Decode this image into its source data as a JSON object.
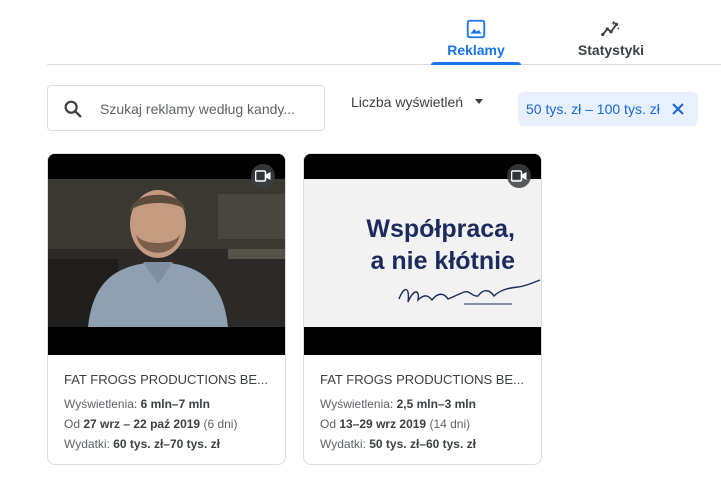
{
  "tabs": [
    {
      "label": "Reklamy",
      "icon": "image-icon",
      "active": true
    },
    {
      "label": "Statystyki",
      "icon": "insights-icon",
      "active": false
    }
  ],
  "search": {
    "placeholder": "Szukaj reklamy według kandy..."
  },
  "filter_dropdown": {
    "label": "Liczba wyświetleń"
  },
  "chip": {
    "label": "50 tys. zł – 100 tys. zł"
  },
  "cards": [
    {
      "advertiser": "FAT FROGS PRODUCTIONS BE...",
      "views_label": "Wyświetlenia:",
      "views_value": "6 mln–7 mln",
      "date_prefix": "Od",
      "date_value": "27 wrz – 22 paź 2019",
      "date_days": "(6 dni)",
      "spend_label": "Wydatki:",
      "spend_value": "60 tys. zł–70 tys. zł"
    },
    {
      "advertiser": "FAT FROGS PRODUCTIONS BE...",
      "views_label": "Wyświetlenia:",
      "views_value": "2,5 mln–3 mln",
      "date_prefix": "Od",
      "date_value": "13–29 wrz 2019",
      "date_days": "(14 dni)",
      "spend_label": "Wydatki:",
      "spend_value": "50 tys. zł–60 tys. zł",
      "thumbnail_line1": "Współpraca,",
      "thumbnail_line2": "a nie kłótnie"
    }
  ],
  "colors": {
    "accent": "#1a73e8",
    "chip_bg": "#e8f0fe",
    "chip_text": "#1967d2"
  }
}
